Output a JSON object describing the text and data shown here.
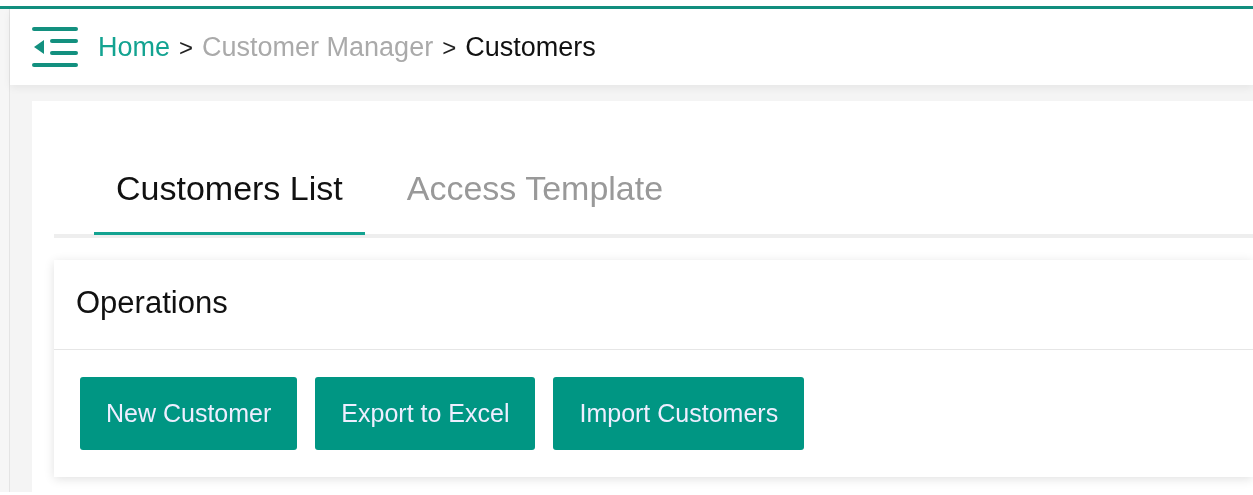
{
  "breadcrumb": {
    "separator": ">",
    "items": [
      {
        "label": "Home",
        "kind": "link"
      },
      {
        "label": "Customer Manager",
        "kind": "muted"
      },
      {
        "label": "Customers",
        "kind": "current"
      }
    ]
  },
  "tabs": [
    {
      "label": "Customers List",
      "selected": true
    },
    {
      "label": "Access Template",
      "selected": false
    }
  ],
  "operations": {
    "title": "Operations",
    "buttons": [
      "New Customer",
      "Export to Excel",
      "Import Customers"
    ]
  }
}
